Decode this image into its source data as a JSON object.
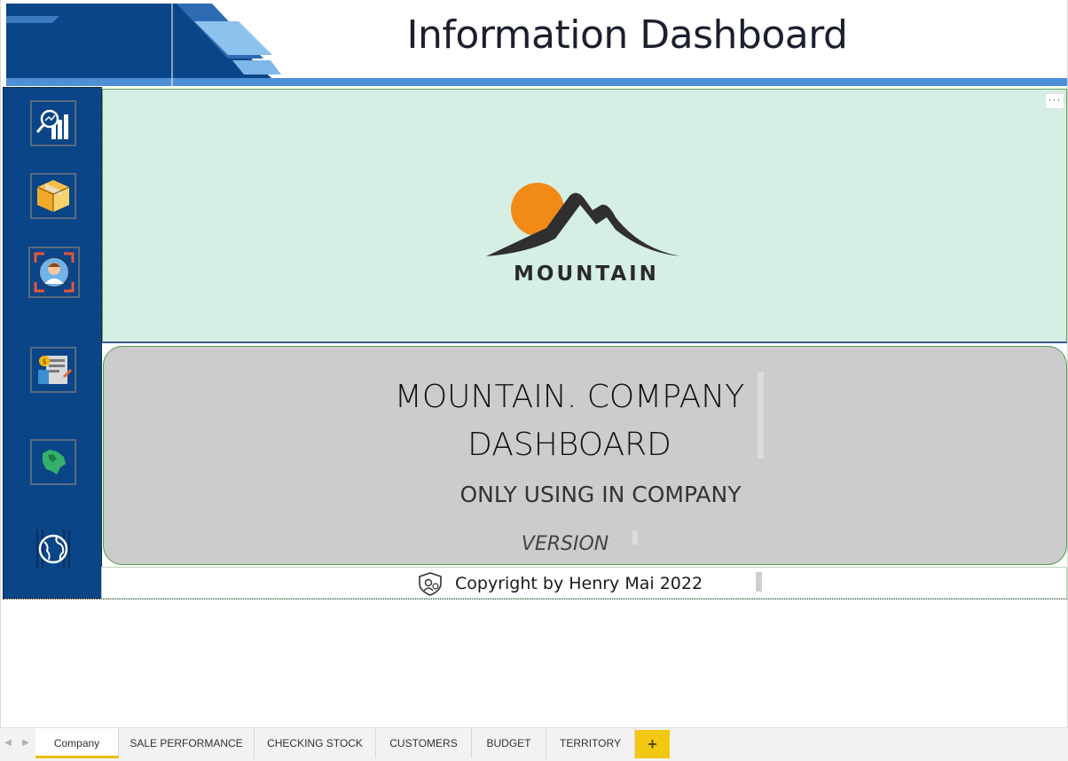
{
  "header": {
    "title": "Information Dashboard"
  },
  "nav": {
    "items": [
      {
        "id": "sale-performance",
        "icon": "sales-chart-icon"
      },
      {
        "id": "checking-stock",
        "icon": "box-icon"
      },
      {
        "id": "customers",
        "icon": "customer-icon"
      },
      {
        "id": "budget",
        "icon": "budget-icon"
      },
      {
        "id": "territory-map",
        "icon": "map-icon"
      },
      {
        "id": "territory-globe",
        "icon": "globe-icon"
      }
    ]
  },
  "logo": {
    "wordmark": "MOUNTAIN"
  },
  "card": {
    "title_line1": "MOUNTAIN. COMPANY",
    "title_line2": "DASHBOARD",
    "subtitle": "ONLY USING IN COMPANY",
    "version": "VERSION"
  },
  "footer": {
    "copyright": "Copyright by Henry Mai 2022"
  },
  "more_options": "···",
  "tabs": [
    {
      "label": "Company",
      "active": true
    },
    {
      "label": "SALE PERFORMANCE",
      "active": false
    },
    {
      "label": "CHECKING STOCK",
      "active": false
    },
    {
      "label": "CUSTOMERS",
      "active": false
    },
    {
      "label": "BUDGET",
      "active": false
    },
    {
      "label": "TERRITORY",
      "active": false
    }
  ],
  "add_page_label": "+",
  "colors": {
    "nav_bg": "#0a4587",
    "logo_panel_bg": "#d5efe4",
    "card_bg": "#cccccc",
    "sun_orange": "#f28a16",
    "active_tab_accent": "#e8c007"
  }
}
